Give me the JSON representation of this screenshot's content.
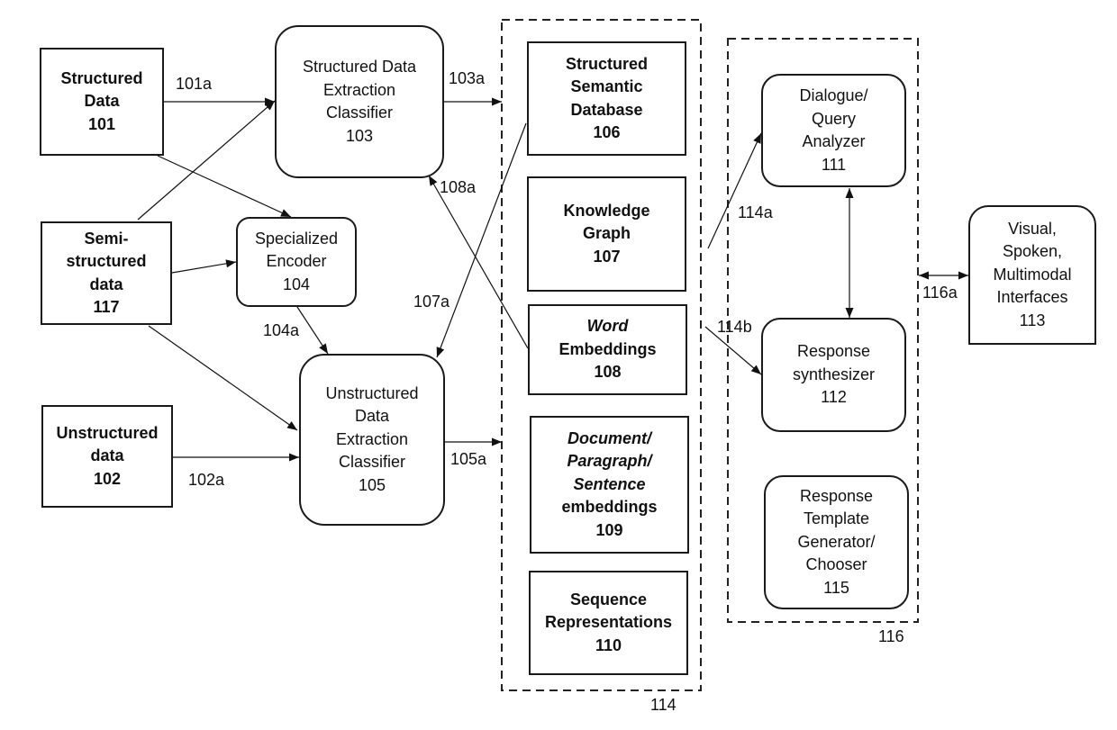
{
  "nodes": {
    "n101": {
      "id": "101",
      "lines": [
        "Structured",
        "Data",
        "101"
      ]
    },
    "n117": {
      "id": "117",
      "lines": [
        "Semi-",
        "structured",
        "data",
        "117"
      ]
    },
    "n102": {
      "id": "102",
      "lines": [
        "Unstructured",
        "data",
        "102"
      ]
    },
    "n103": {
      "id": "103",
      "lines": [
        "Structured Data",
        "Extraction",
        "Classifier",
        "103"
      ]
    },
    "n104": {
      "id": "104",
      "lines": [
        "Specialized",
        "Encoder",
        "104"
      ]
    },
    "n105": {
      "id": "105",
      "lines": [
        "Unstructured",
        "Data",
        "Extraction",
        "Classifier",
        "105"
      ]
    },
    "n106": {
      "id": "106",
      "lines": [
        "Structured",
        "Semantic",
        "Database",
        "106"
      ]
    },
    "n107": {
      "id": "107",
      "lines": [
        "Knowledge",
        "Graph",
        "107"
      ]
    },
    "n108": {
      "id": "108",
      "lines": [
        "Word",
        "Embeddings",
        "108"
      ],
      "italic_lines": [
        0
      ]
    },
    "n109": {
      "id": "109",
      "lines": [
        "Document/",
        "Paragraph/",
        "Sentence",
        "embeddings",
        "109"
      ],
      "italic_lines": [
        0,
        1,
        2
      ]
    },
    "n110": {
      "id": "110",
      "lines": [
        "Sequence",
        "Representations",
        "110"
      ]
    },
    "n111": {
      "id": "111",
      "lines": [
        "Dialogue/",
        "Query",
        "Analyzer",
        "111"
      ]
    },
    "n112": {
      "id": "112",
      "lines": [
        "Response",
        "synthesizer",
        "112"
      ]
    },
    "n113": {
      "id": "113",
      "lines": [
        "Visual,",
        "Spoken,",
        "Multimodal",
        "Interfaces",
        "113"
      ]
    },
    "n115": {
      "id": "115",
      "lines": [
        "Response",
        "Template",
        "Generator/",
        "Chooser",
        "115"
      ]
    }
  },
  "containers": {
    "c114": {
      "label": "114",
      "contains": [
        "106",
        "107",
        "108",
        "109",
        "110"
      ]
    },
    "c116": {
      "label": "116",
      "contains": [
        "111",
        "112",
        "115"
      ]
    }
  },
  "edges": [
    {
      "from": "101",
      "to": "103",
      "label": "101a"
    },
    {
      "from": "117",
      "to": "103",
      "label": null
    },
    {
      "from": "101",
      "to": "104",
      "label": null
    },
    {
      "from": "117",
      "to": "104",
      "label": null
    },
    {
      "from": "103",
      "to": "114",
      "label": "103a"
    },
    {
      "from": "104",
      "to": "105",
      "label": "104a"
    },
    {
      "from": "117",
      "to": "105",
      "label": null
    },
    {
      "from": "102",
      "to": "105",
      "label": "102a"
    },
    {
      "from": "105",
      "to": "114",
      "label": "105a"
    },
    {
      "from": "106",
      "to": "105",
      "label": "107a"
    },
    {
      "from": "108",
      "to": "103",
      "label": "108a"
    },
    {
      "from": "114",
      "to": "111",
      "label": "114a"
    },
    {
      "from": "114",
      "to": "112",
      "label": "114b"
    },
    {
      "from": "111",
      "to": "112",
      "label": null,
      "bidirectional": true
    },
    {
      "from": "116",
      "to": "113",
      "label": "116a",
      "bidirectional": true
    }
  ]
}
